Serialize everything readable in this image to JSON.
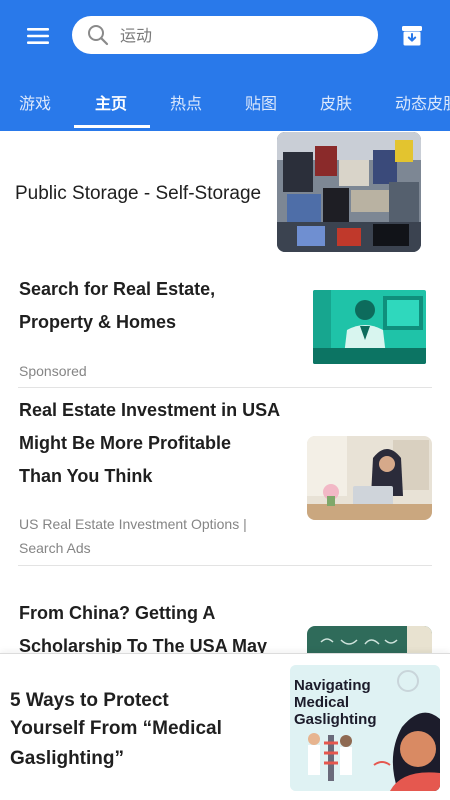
{
  "search": {
    "placeholder": "运动"
  },
  "tabs": [
    "游戏",
    "主页",
    "热点",
    "贴图",
    "皮肤",
    "动态皮肤"
  ],
  "feed": {
    "item1": {
      "title": "Public Storage - Self-Storage",
      "image": "storage-room-clutter-photo"
    },
    "item2": {
      "title_line1": "Search for Real Estate,",
      "title_line2": "Property & Homes",
      "source": "Sponsored",
      "image": "businessman-at-desk-photo"
    },
    "item3": {
      "title_line1": "Real Estate Investment in USA",
      "title_line2": "Might Be More Profitable",
      "title_line3": "Than You Think",
      "source_line1": "US Real Estate Investment Options |",
      "source_line2": "Search Ads",
      "image": "woman-with-laptop-photo"
    },
    "item4": {
      "title_line1": "From China? Getting A",
      "title_line2": "Scholarship To The USA May",
      "image": "chalkboard-photo"
    }
  },
  "bottom_ad": {
    "title_line1": "5 Ways to Protect",
    "title_line2": "Yourself From “Medical",
    "title_line3": "Gaslighting”",
    "image_text_line1": "Navigating",
    "image_text_line2": "Medical",
    "image_text_line3": "Gaslighting"
  },
  "colors": {
    "header": "#2979ea",
    "tab_inactive": "#dbe8fc",
    "text": "#1f1f1f",
    "meta": "#858585"
  },
  "icons": {
    "menu": "hamburger-menu-icon",
    "search": "search-icon",
    "archive": "archive-download-icon"
  }
}
